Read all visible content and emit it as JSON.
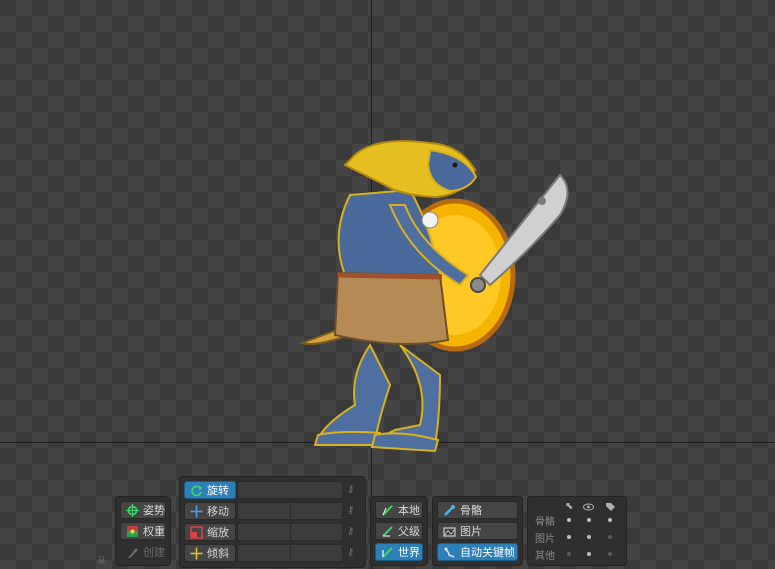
{
  "tools": {
    "pose": "姿势",
    "weights": "权重",
    "create": "创建"
  },
  "transform": {
    "rotate": "旋转",
    "translate": "移动",
    "scale": "缩放",
    "shear": "倾斜"
  },
  "axes": {
    "local": "本地",
    "parent": "父级",
    "world": "世界"
  },
  "key_options": {
    "bones": "骨骼",
    "images": "图片",
    "auto_key": "自动关键帧"
  },
  "visibility": {
    "bones": "骨骼",
    "images": "图片",
    "others": "其他"
  },
  "colors": {
    "accent": "#2d7fb8",
    "viewport_bg": "#3a3a3a"
  }
}
